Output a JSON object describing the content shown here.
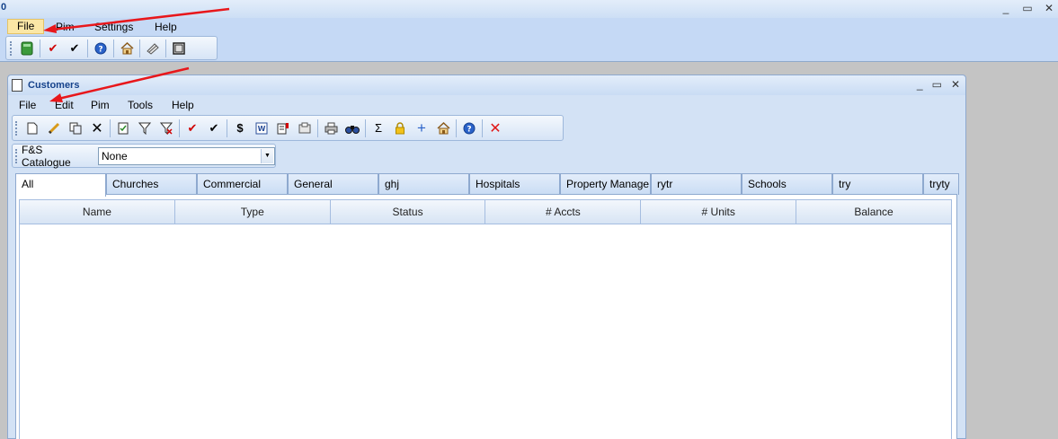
{
  "app": {
    "title": "0",
    "menu": {
      "file": "File",
      "pim": "Pim",
      "settings": "Settings",
      "help": "Help"
    }
  },
  "child": {
    "title": "Customers",
    "menu": {
      "file": "File",
      "edit": "Edit",
      "pim": "Pim",
      "tools": "Tools",
      "help": "Help"
    },
    "catalogue": {
      "label": "F&S Catalogue",
      "value": "None"
    },
    "tabs": [
      "All",
      "Churches",
      "Commercial",
      "General",
      "ghj",
      "Hospitals",
      "Property Manage",
      "rytr",
      "Schools",
      "try",
      "tryty"
    ],
    "active_tab": "All",
    "columns": [
      "Name",
      "Type",
      "Status",
      "# Accts",
      "# Units",
      "Balance"
    ]
  },
  "colors": {
    "annotation_arrow": "#e8171b",
    "accent": "#15428b",
    "check_red": "#d00000"
  },
  "icons": {
    "app_toolbar": [
      "database-icon",
      "check-red-icon",
      "check-black-icon",
      "help-icon",
      "home-icon",
      "book-icon",
      "frame-icon"
    ],
    "child_toolbar": [
      "new-icon",
      "edit-pencil-icon",
      "copy-icon",
      "delete-icon",
      "report-icon",
      "filter-icon",
      "clear-filter-icon",
      "check-red-icon",
      "check-black-icon",
      "dollar-icon",
      "word-icon",
      "note-icon",
      "attach-icon",
      "print-icon",
      "find-icon",
      "sigma-icon",
      "lock-icon",
      "plus-icon",
      "home-icon",
      "help-icon",
      "close-red-icon"
    ]
  }
}
